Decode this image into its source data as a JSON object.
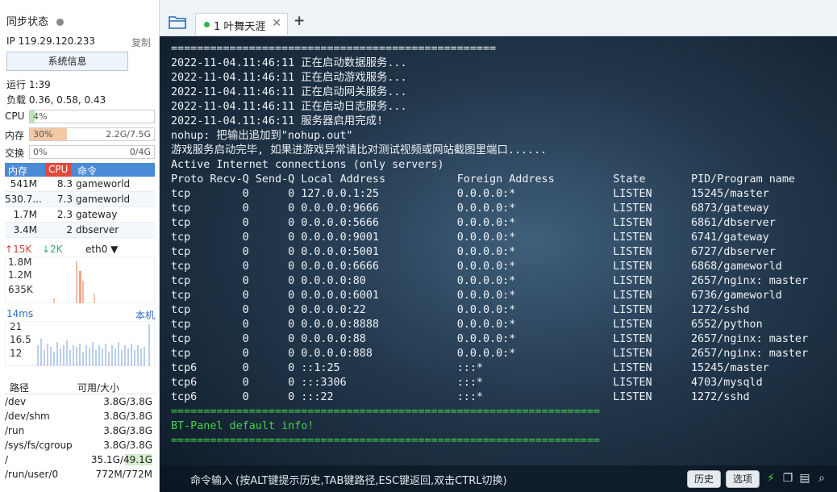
{
  "sidebar": {
    "sync_status": "同步状态",
    "ip": "IP 119.29.120.233",
    "copy_label": "复制",
    "sysinfo_button": "系统信息",
    "uptime": "运行 1:39",
    "load": "负载 0.36, 0.58, 0.43",
    "cpu": {
      "label": "CPU",
      "percent_text": "4%",
      "percent": 4
    },
    "mem": {
      "label": "内存",
      "percent_text": "30%",
      "percent": 30,
      "value": "2.2G/7.5G"
    },
    "swap": {
      "label": "交换",
      "percent_text": "0%",
      "percent": 0,
      "value": "0/4G"
    },
    "process_table": {
      "headers": [
        "内存",
        "CPU",
        "命令"
      ],
      "rows": [
        {
          "mem": "541M",
          "cpu": "8.3",
          "cmd": "gameworld"
        },
        {
          "mem": "530.7...",
          "cpu": "7.3",
          "cmd": "gameworld"
        },
        {
          "mem": "1.7M",
          "cpu": "2.3",
          "cmd": "gateway"
        },
        {
          "mem": "3.4M",
          "cpu": "2",
          "cmd": "dbserver"
        }
      ]
    },
    "network": {
      "upload": "15K",
      "download": "2K",
      "interface": "eth0",
      "y_labels": [
        "1.8M",
        "1.2M",
        "635K"
      ]
    },
    "ping": {
      "latency": "14ms",
      "target": "本机",
      "y_labels": [
        "21",
        "16.5",
        "12"
      ]
    },
    "disk_table": {
      "headers": [
        "路径",
        "可用/大小"
      ],
      "rows": [
        {
          "path": "/dev",
          "value": "3.8G/3.8G"
        },
        {
          "path": "/dev/shm",
          "value": "3.8G/3.8G"
        },
        {
          "path": "/run",
          "value": "3.8G/3.8G"
        },
        {
          "path": "/sys/fs/cgroup",
          "value": "3.8G/3.8G"
        },
        {
          "path": "/",
          "value": "35.1G/49.1G"
        },
        {
          "path": "/run/user/0",
          "value": "772M/772M"
        }
      ]
    }
  },
  "tabs": [
    {
      "label": "1 叶舞天涯",
      "active": true
    }
  ],
  "terminal": {
    "lines": [
      {
        "text": "==================================================",
        "style": "normal"
      },
      {
        "text": "2022-11-04.11:46:11 正在启动数据服务...",
        "style": "normal"
      },
      {
        "text": "2022-11-04.11:46:11 正在启动游戏服务...",
        "style": "normal"
      },
      {
        "text": "2022-11-04.11:46:11 正在启动网关服务...",
        "style": "normal"
      },
      {
        "text": "2022-11-04.11:46:11 正在启动日志服务...",
        "style": "normal"
      },
      {
        "text": "2022-11-04.11:46:11 服务器启用完成!",
        "style": "normal"
      },
      {
        "text": "nohup: 把输出追加到\"nohup.out\"",
        "style": "normal"
      },
      {
        "text": "游戏服务启动完毕, 如果进游戏异常请比对测试视频或网站截图里端口......",
        "style": "normal"
      },
      {
        "text": "Active Internet connections (only servers)",
        "style": "normal"
      },
      {
        "text": "Proto Recv-Q Send-Q Local Address           Foreign Address         State       PID/Program name",
        "style": "normal"
      },
      {
        "text": "tcp        0      0 127.0.0.1:25            0.0.0.0:*               LISTEN      15245/master",
        "style": "normal"
      },
      {
        "text": "tcp        0      0 0.0.0.0:9666            0.0.0.0:*               LISTEN      6873/gateway",
        "style": "normal"
      },
      {
        "text": "tcp        0      0 0.0.0.0:5666            0.0.0.0:*               LISTEN      6861/dbserver",
        "style": "normal"
      },
      {
        "text": "tcp        0      0 0.0.0.0:9001            0.0.0.0:*               LISTEN      6741/gateway",
        "style": "normal"
      },
      {
        "text": "tcp        0      0 0.0.0.0:5001            0.0.0.0:*               LISTEN      6727/dbserver",
        "style": "normal"
      },
      {
        "text": "tcp        0      0 0.0.0.0:6666            0.0.0.0:*               LISTEN      6868/gameworld",
        "style": "normal"
      },
      {
        "text": "tcp        0      0 0.0.0.0:80              0.0.0.0:*               LISTEN      2657/nginx: master",
        "style": "normal"
      },
      {
        "text": "tcp        0      0 0.0.0.0:6001            0.0.0.0:*               LISTEN      6736/gameworld",
        "style": "normal"
      },
      {
        "text": "tcp        0      0 0.0.0.0:22              0.0.0.0:*               LISTEN      1272/sshd",
        "style": "normal"
      },
      {
        "text": "tcp        0      0 0.0.0.0:8888            0.0.0.0:*               LISTEN      6552/python",
        "style": "normal"
      },
      {
        "text": "tcp        0      0 0.0.0.0:88              0.0.0.0:*               LISTEN      2657/nginx: master",
        "style": "normal"
      },
      {
        "text": "tcp        0      0 0.0.0.0:888             0.0.0.0:*               LISTEN      2657/nginx: master",
        "style": "normal"
      },
      {
        "text": "tcp6       0      0 ::1:25                  :::*                    LISTEN      15245/master",
        "style": "normal"
      },
      {
        "text": "tcp6       0      0 :::3306                 :::*                    LISTEN      4703/mysqld",
        "style": "normal"
      },
      {
        "text": "tcp6       0      0 :::22                   :::*                    LISTEN      1272/sshd",
        "style": "normal"
      },
      {
        "text": "==================================================================",
        "style": "ok"
      },
      {
        "text": "BT-Panel default info!",
        "style": "ok"
      },
      {
        "text": "==================================================================",
        "style": "ok"
      }
    ]
  },
  "command_bar": {
    "hint": "命令输入 (按ALT键提示历史,TAB键路径,ESC键返回,双击CTRL切换)",
    "history_button": "历史",
    "options_button": "选项"
  },
  "colors": {
    "accent": "#4a8ad6",
    "cpu_bar": "#b8e6b0",
    "mem_bar": "#f5c8a4",
    "terminal_ok": "#46d24a"
  }
}
